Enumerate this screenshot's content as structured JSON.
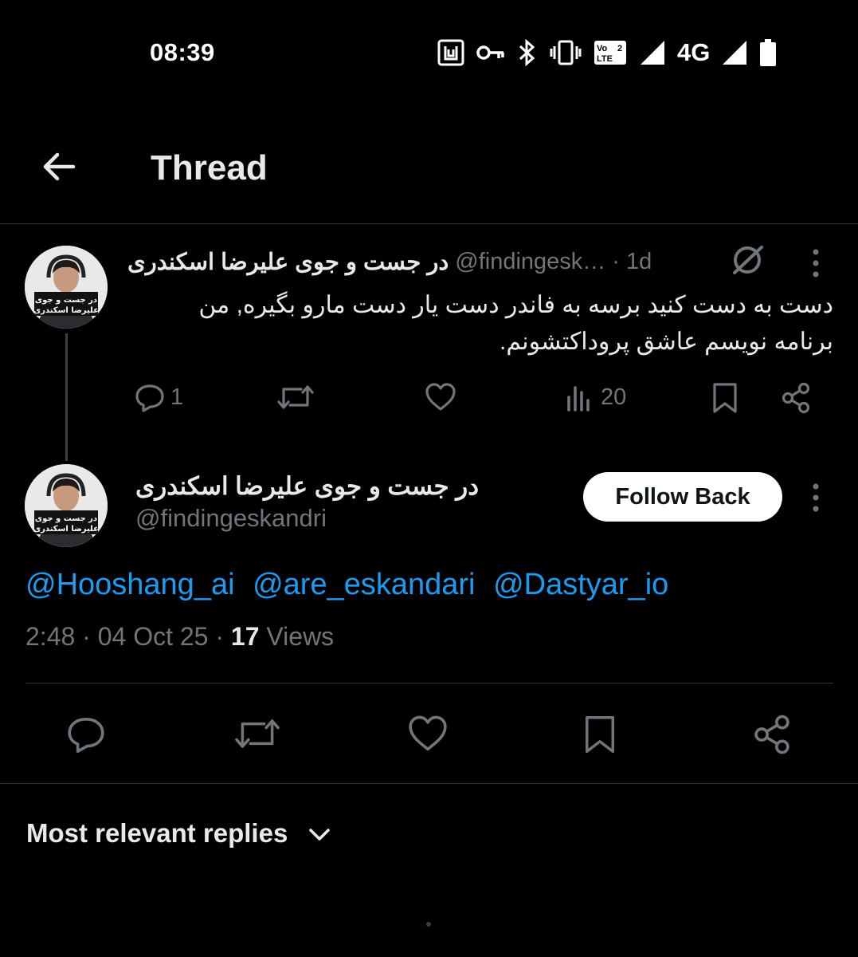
{
  "status_bar": {
    "time": "08:39",
    "network": "4G",
    "volte": "Vo LTE 2"
  },
  "header": {
    "title": "Thread"
  },
  "tweet1": {
    "name": "در جست و جوی علیرضا اسکندری",
    "handle": "@findingesk…",
    "separator": "·",
    "time": "1d",
    "body": "دست به دست کنید برسه به فاندر دست یار دست مارو بگیره, من برنامه نویسم عاشق پروداکتشونم.",
    "reply_count": "1",
    "view_count": "20"
  },
  "tweet2": {
    "name": "در جست و جوی علیرضا اسکندری",
    "handle": "@findingeskandri",
    "follow_label": "Follow Back",
    "mentions": [
      "@Hooshang_ai",
      "@are_eskandari",
      "@Dastyar_io"
    ],
    "meta_time": "2:48",
    "meta_sep": "·",
    "meta_date": "04 Oct 25",
    "meta_views_count": "17",
    "meta_views_label": "Views"
  },
  "avatar": {
    "caption_line1": "در جست و جوی",
    "caption_line2": "علیرضا اسکندری"
  },
  "replies": {
    "sort_label": "Most relevant replies"
  },
  "colors": {
    "background": "#000000",
    "text": "#e7e9ea",
    "muted": "#71767b",
    "link": "#1d9bf0",
    "divider": "#2f3336"
  }
}
